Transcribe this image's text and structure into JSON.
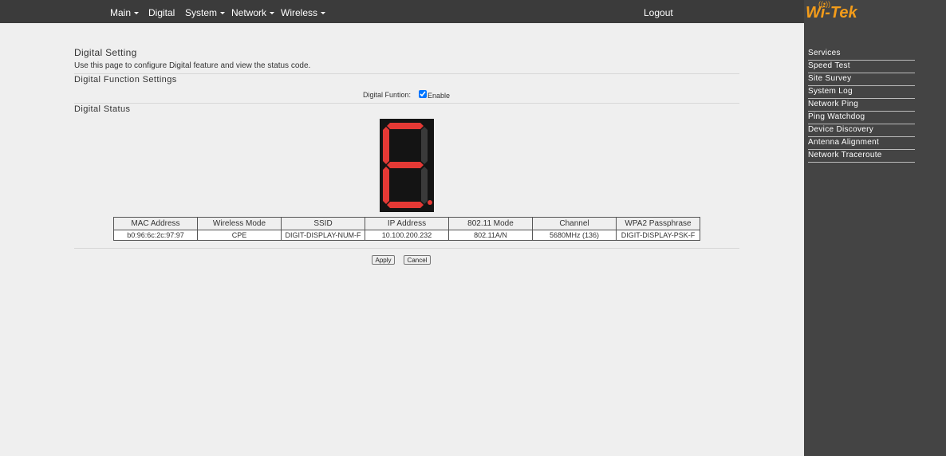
{
  "nav": {
    "items": [
      {
        "label": "Main",
        "has_caret": true
      },
      {
        "label": "Digital",
        "has_caret": false
      },
      {
        "label": "System",
        "has_caret": true
      },
      {
        "label": "Network",
        "has_caret": true
      },
      {
        "label": "Wireless",
        "has_caret": true
      }
    ],
    "logout_label": "Logout"
  },
  "brand": {
    "logo_text": "Wi-Tek",
    "accent_color": "#f39c1a"
  },
  "sidebar": {
    "items": [
      {
        "label": "Services"
      },
      {
        "label": "Speed Test"
      },
      {
        "label": "Site Survey"
      },
      {
        "label": "System Log"
      },
      {
        "label": "Network Ping"
      },
      {
        "label": "Ping Watchdog"
      },
      {
        "label": "Device Discovery"
      },
      {
        "label": "Antenna Alignment"
      },
      {
        "label": "Network Traceroute"
      }
    ]
  },
  "page": {
    "title": "Digital Setting",
    "description": "Use this page to configure Digital feature and view the status code.",
    "function_section_title": "Digital Function Settings",
    "function_label": "Digital Funtion:",
    "function_enabled": true,
    "function_enable_label": "Enable",
    "status_section_title": "Digital Status",
    "display": {
      "code": "E",
      "segment_on_color": "#e53935",
      "segment_off_color": "#3a3a3a",
      "dot_on": true
    }
  },
  "status_table": {
    "headers": [
      "MAC Address",
      "Wireless Mode",
      "SSID",
      "IP Address",
      "802.11 Mode",
      "Channel",
      "WPA2 Passphrase"
    ],
    "row": [
      "b0:96:6c:2c:97:97",
      "CPE",
      "DIGIT-DISPLAY-NUM-F",
      "10.100.200.232",
      "802.11A/N",
      "5680MHz (136)",
      "DIGIT-DISPLAY-PSK-F"
    ]
  },
  "buttons": {
    "apply_label": "Apply",
    "cancel_label": "Cancel"
  }
}
